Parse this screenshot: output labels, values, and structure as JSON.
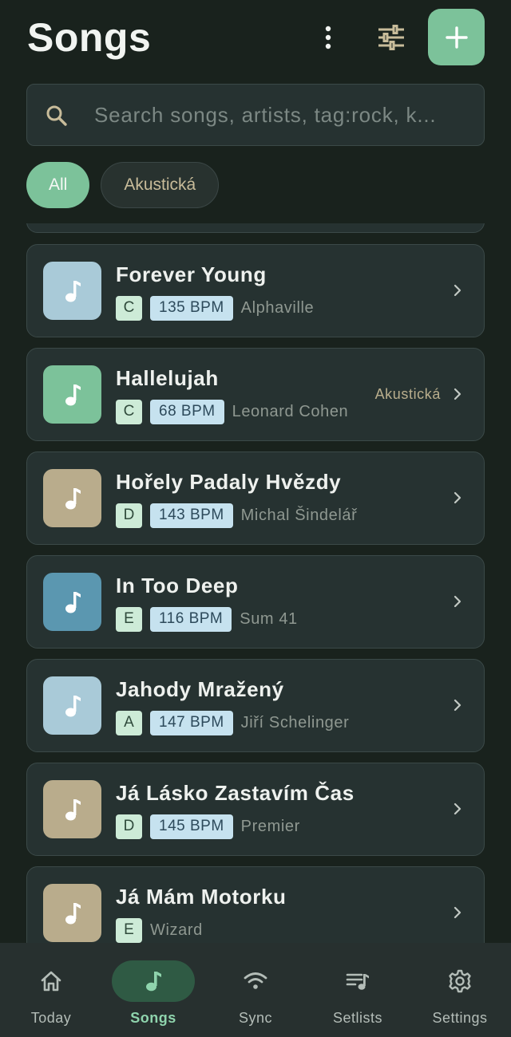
{
  "header": {
    "title": "Songs",
    "icons": {
      "more": "more-vert-icon",
      "filter": "tune-sliders-icon",
      "add": "plus-icon"
    }
  },
  "search": {
    "placeholder": "Search songs, artists, tag:rock, k...",
    "value": "",
    "icon": "search-icon"
  },
  "filters": [
    {
      "label": "All",
      "active": true
    },
    {
      "label": "Akustická",
      "active": false
    }
  ],
  "songs": [
    {
      "title": "Forever Young",
      "key": "C",
      "bpm": "135 BPM",
      "artist": "Alphaville",
      "tag": "",
      "thumb_color": "#a9cad8"
    },
    {
      "title": "Hallelujah",
      "key": "C",
      "bpm": "68 BPM",
      "artist": "Leonard Cohen",
      "tag": "Akustická",
      "thumb_color": "#7cc29a"
    },
    {
      "title": "Hořely Padaly Hvězdy",
      "key": "D",
      "bpm": "143 BPM",
      "artist": "Michal Šindelář",
      "tag": "",
      "thumb_color": "#b9ac8c"
    },
    {
      "title": "In Too Deep",
      "key": "E",
      "bpm": "116 BPM",
      "artist": "Sum 41",
      "tag": "",
      "thumb_color": "#5b97b0"
    },
    {
      "title": "Jahody Mražený",
      "key": "A",
      "bpm": "147 BPM",
      "artist": "Jiří Schelinger",
      "tag": "",
      "thumb_color": "#a9cad8"
    },
    {
      "title": "Já Lásko Zastavím Čas",
      "key": "D",
      "bpm": "145 BPM",
      "artist": "Premier",
      "tag": "",
      "thumb_color": "#b9ac8c"
    },
    {
      "title": "Já Mám Motorku",
      "key": "E",
      "bpm": "",
      "artist": "Wizard",
      "tag": "",
      "thumb_color": "#b9ac8c"
    }
  ],
  "nav": [
    {
      "label": "Today",
      "icon": "home-icon",
      "active": false
    },
    {
      "label": "Songs",
      "icon": "music-note-icon",
      "active": true
    },
    {
      "label": "Sync",
      "icon": "wifi-icon",
      "active": false
    },
    {
      "label": "Setlists",
      "icon": "playlist-icon",
      "active": false
    },
    {
      "label": "Settings",
      "icon": "gear-icon",
      "active": false
    }
  ],
  "colors": {
    "accent": "#7cc29a",
    "background": "#19221d",
    "card": "#263231",
    "key_badge": "#cdebd7",
    "bpm_badge": "#c6e2ef",
    "tag_text": "#b9ae8d"
  }
}
